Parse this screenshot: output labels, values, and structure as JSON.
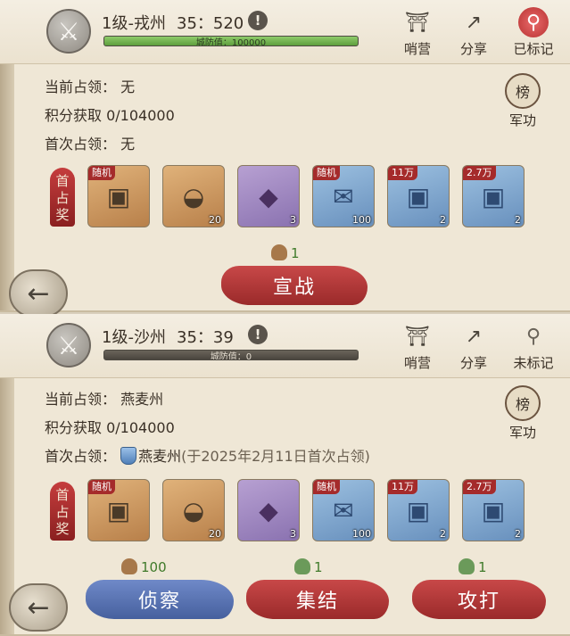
{
  "panels": [
    {
      "city_name": "1级-戎州",
      "coords": "35：520",
      "wall_label": "城防值：100000",
      "wall_fill": 1.0,
      "header_buttons": [
        {
          "label": "哨营",
          "icon": "outpost-icon"
        },
        {
          "label": "分享",
          "icon": "share-icon"
        },
        {
          "label": "已标记",
          "icon": "marker-icon"
        }
      ],
      "occupier_label": "当前占领：",
      "occupier_value": "无",
      "points_label": "积分获取",
      "points_value": "0/104000",
      "first_label": "首次占领：",
      "first_value": "无",
      "merit_label": "军功",
      "merit_scroll": "榜",
      "reward_tag": "首占奖",
      "rewards": [
        {
          "tag": "随机",
          "qty": "",
          "icon": "chest-icon"
        },
        {
          "tag": "",
          "qty": "20",
          "icon": "gold-ingot-icon"
        },
        {
          "tag": "",
          "qty": "3",
          "icon": "ore-icon"
        },
        {
          "tag": "随机",
          "qty": "100",
          "icon": "scroll-icon"
        },
        {
          "tag": "11万",
          "qty": "2",
          "icon": "blue-chest-icon"
        },
        {
          "tag": "2.7万",
          "qty": "2",
          "icon": "blue-chest-icon"
        }
      ],
      "cost": "1",
      "actions": [
        "宣战"
      ]
    },
    {
      "city_name": "1级-沙州",
      "coords": "35：39",
      "wall_label": "城防值：0",
      "wall_fill": 0,
      "header_buttons": [
        {
          "label": "哨营",
          "icon": "outpost-icon"
        },
        {
          "label": "分享",
          "icon": "share-icon"
        },
        {
          "label": "未标记",
          "icon": "marker-icon"
        }
      ],
      "occupier_label": "当前占领：",
      "occupier_value": "燕麦州",
      "points_label": "积分获取",
      "points_value": "0/104000",
      "first_label": "首次占领：",
      "first_value": "燕麦州",
      "first_detail": "(于2025年2月11日首次占领)",
      "merit_label": "军功",
      "merit_scroll": "榜",
      "reward_tag": "首占奖",
      "rewards": [
        {
          "tag": "随机",
          "qty": "",
          "icon": "chest-icon"
        },
        {
          "tag": "",
          "qty": "20",
          "icon": "gold-ingot-icon"
        },
        {
          "tag": "",
          "qty": "3",
          "icon": "ore-icon"
        },
        {
          "tag": "随机",
          "qty": "100",
          "icon": "scroll-icon"
        },
        {
          "tag": "11万",
          "qty": "2",
          "icon": "blue-chest-icon"
        },
        {
          "tag": "2.7万",
          "qty": "2",
          "icon": "blue-chest-icon"
        }
      ],
      "costs": [
        "100",
        "1",
        "1"
      ],
      "actions": [
        "侦察",
        "集结",
        "攻打"
      ]
    }
  ],
  "colors": {
    "red_button": "#b83a3a",
    "blue_button": "#5a73b4",
    "cost_green": "#3f7a2a"
  }
}
